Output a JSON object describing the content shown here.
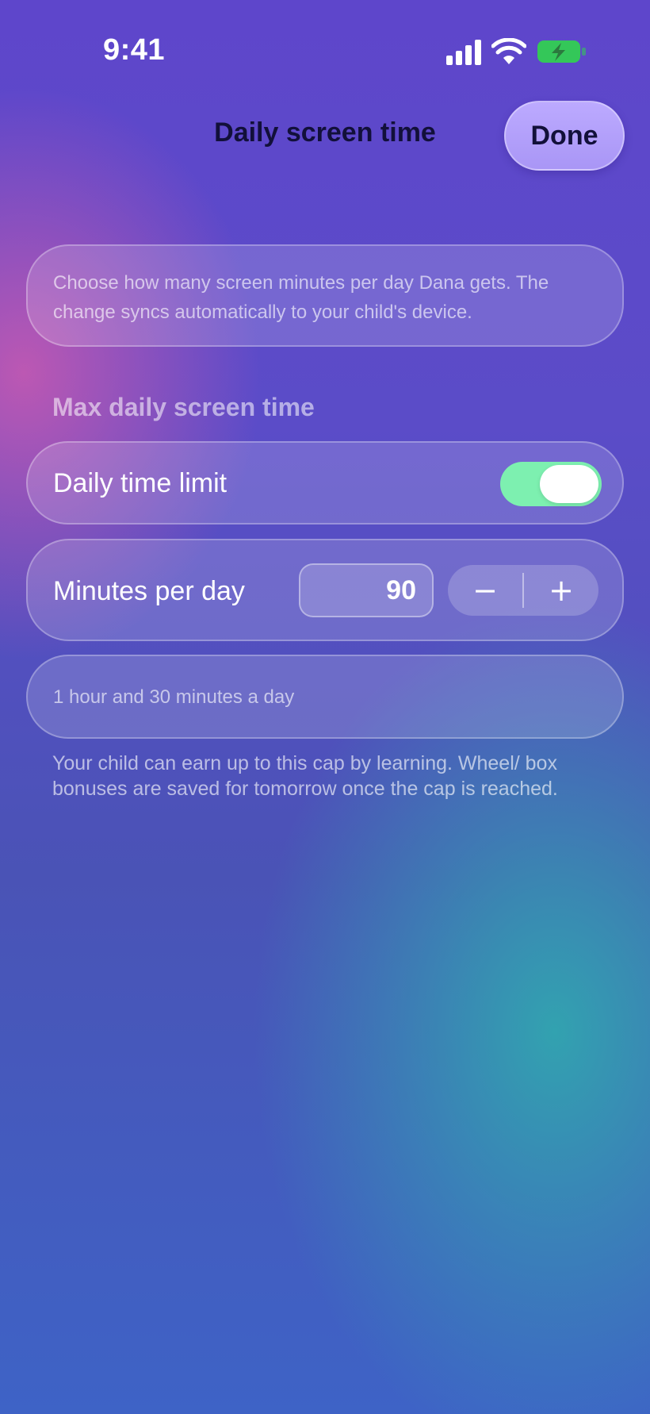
{
  "status_bar": {
    "time": "9:41",
    "icons": [
      "cellular-signal-icon",
      "wifi-icon",
      "battery-charging-icon"
    ],
    "battery_color": "#34c759"
  },
  "nav": {
    "title": "Daily screen time",
    "done_label": "Done"
  },
  "info": {
    "text": "Choose how many screen minutes per day Dana gets. The change syncs automatically to your child's device."
  },
  "section": {
    "header": "Max daily screen time"
  },
  "toggle_row": {
    "label": "Daily time limit",
    "on": true,
    "on_color": "#7df0b0"
  },
  "minutes_row": {
    "label": "Minutes per day",
    "value": "90",
    "decrement_symbol": "−",
    "increment_symbol": "+"
  },
  "summary": {
    "text": "1 hour and 30 minutes a day"
  },
  "footnote": {
    "text": "Your child can earn up to this cap by learning. Wheel/ box bonuses are saved for tomorrow once the cap is reached."
  }
}
